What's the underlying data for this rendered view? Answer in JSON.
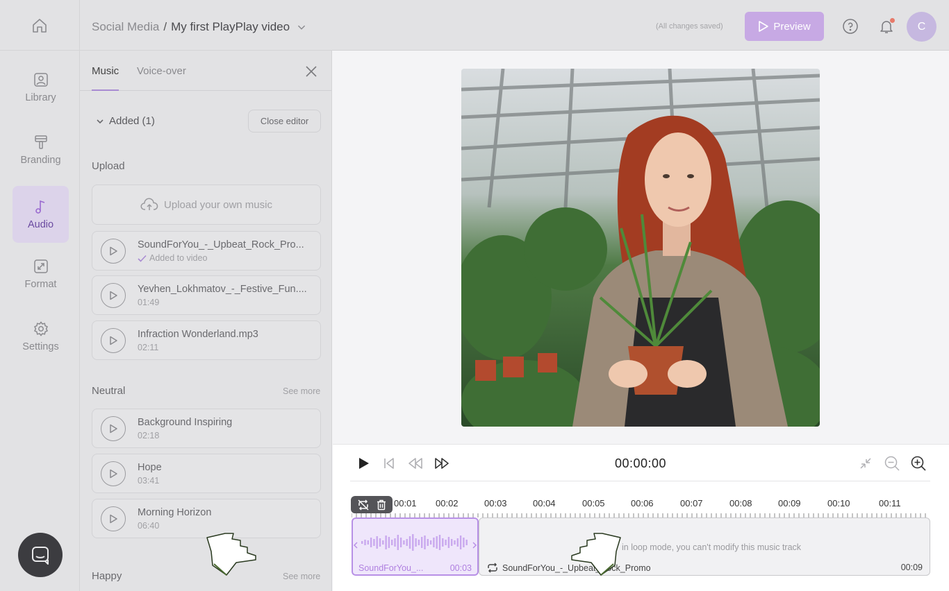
{
  "header": {
    "breadcrumb_root": "Social Media",
    "breadcrumb_sep": "/",
    "breadcrumb_current": "My first PlayPlay video",
    "save_status": "(All changes saved)",
    "preview_label": "Preview",
    "avatar_initial": "C"
  },
  "leftnav": {
    "items": [
      {
        "label": "Library",
        "icon": "image-icon"
      },
      {
        "label": "Branding",
        "icon": "paint-roller-icon"
      },
      {
        "label": "Audio",
        "icon": "music-note-icon",
        "active": true
      },
      {
        "label": "Format",
        "icon": "resize-icon"
      },
      {
        "label": "Settings",
        "icon": "gear-icon"
      }
    ]
  },
  "panel": {
    "tabs": [
      "Music",
      "Voice-over"
    ],
    "added_label": "Added (1)",
    "close_editor_label": "Close editor",
    "upload_title": "Upload",
    "upload_label": "Upload your own music",
    "uploaded_tracks": [
      {
        "name": "SoundForYou_-_Upbeat_Rock_Pro...",
        "sub": "Added to video"
      },
      {
        "name": "Yevhen_Lokhmatov_-_Festive_Fun....",
        "sub": "01:49"
      },
      {
        "name": "Infraction Wonderland.mp3",
        "sub": "02:11"
      }
    ],
    "neutral_title": "Neutral",
    "neutral_see_more": "See more",
    "neutral_tracks": [
      {
        "name": "Background Inspiring",
        "sub": "02:18"
      },
      {
        "name": "Hope",
        "sub": "03:41"
      },
      {
        "name": "Morning Horizon",
        "sub": "06:40"
      }
    ],
    "happy_title": "Happy",
    "happy_see_more": "See more"
  },
  "timeline": {
    "timecode": "00:00:00",
    "ticks": [
      "00:01",
      "00:02",
      "00:03",
      "00:04",
      "00:05",
      "00:06",
      "00:07",
      "00:08",
      "00:09",
      "00:10",
      "00:11"
    ],
    "selected_clip": {
      "name": "SoundForYou_...",
      "duration": "00:03"
    },
    "loop_clip": {
      "message": "in loop mode, you can't modify this music track",
      "name": "SoundForYou_-_Upbeat_Rock_Promo",
      "duration": "00:09"
    }
  },
  "colors": {
    "accent": "#c7a9e4",
    "accent_dark": "#6a4aa0",
    "overlay": "#e2e2e4"
  }
}
